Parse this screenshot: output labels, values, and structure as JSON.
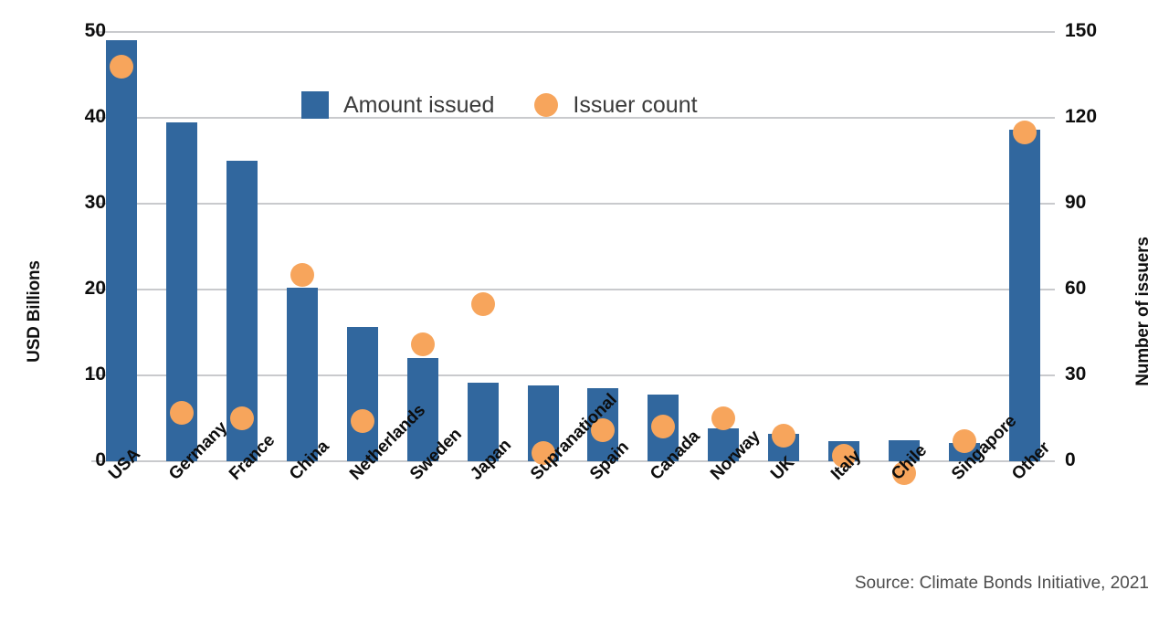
{
  "source_note": "Source: Climate Bonds Initiative, 2021",
  "legend": {
    "position": "inside-top-center",
    "entries": [
      {
        "label": "Amount issued",
        "marker": "square",
        "color": "#31679E"
      },
      {
        "label": "Issuer count",
        "marker": "circle",
        "color": "#F7A55C"
      }
    ]
  },
  "chart_data": {
    "type": "bar",
    "title": "",
    "subtitle": "",
    "xlabel": "",
    "ylabel": "USD Billions",
    "y2label": "Number of issuers",
    "grid": true,
    "ylim": [
      0,
      50
    ],
    "y2lim": [
      0,
      150
    ],
    "yticks": [
      "0",
      "10",
      "20",
      "30",
      "40",
      "50"
    ],
    "y2ticks": [
      "0",
      "30",
      "60",
      "90",
      "120",
      "150"
    ],
    "categories": [
      "USA",
      "Germany",
      "France",
      "China",
      "Netherlands",
      "Sweden",
      "Japan",
      "Supranational",
      "Spain",
      "Canada",
      "Norway",
      "UK",
      "Italy",
      "Chile",
      "Singapore",
      "Other"
    ],
    "series": [
      {
        "name": "Amount issued",
        "type": "bar",
        "axis": "left",
        "unit": "USD Billions",
        "color": "#31679E",
        "values": [
          49.0,
          39.5,
          35.0,
          20.2,
          15.6,
          12.0,
          9.2,
          8.8,
          8.5,
          7.8,
          3.8,
          3.2,
          2.3,
          2.4,
          2.1,
          38.6
        ]
      },
      {
        "name": "Issuer count",
        "type": "scatter",
        "axis": "right",
        "unit": "Number of issuers",
        "color": "#F7A55C",
        "values": [
          138,
          17,
          15,
          65,
          14,
          41,
          55,
          3,
          11,
          12,
          15,
          9,
          2,
          -4,
          7,
          115
        ]
      }
    ]
  }
}
